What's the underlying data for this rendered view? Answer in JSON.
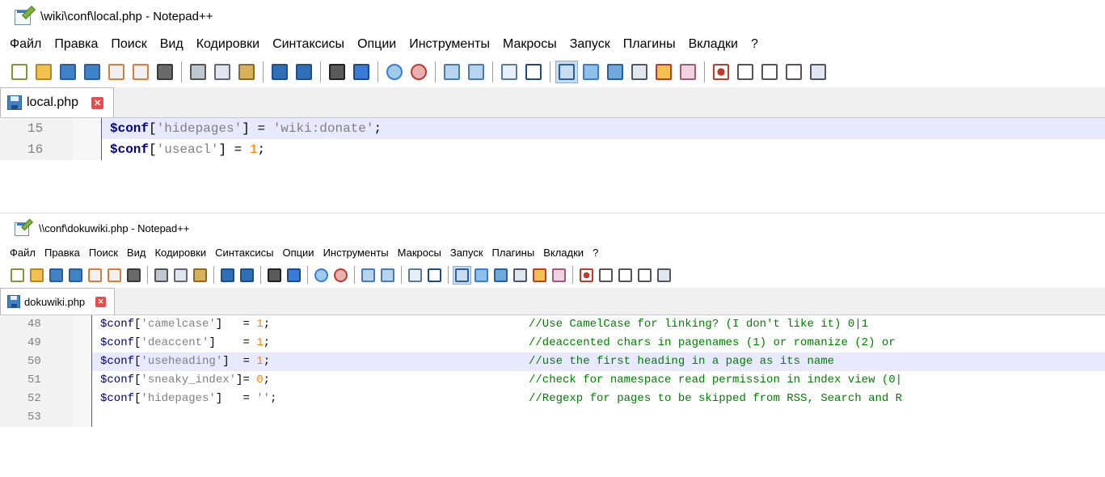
{
  "window1": {
    "title": "\\wiki\\conf\\local.php - Notepad++",
    "menu": [
      "Файл",
      "Правка",
      "Поиск",
      "Вид",
      "Кодировки",
      "Синтаксисы",
      "Опции",
      "Инструменты",
      "Макросы",
      "Запуск",
      "Плагины",
      "Вкладки",
      "?"
    ],
    "tab_label": "local.php",
    "lines": [
      {
        "num": "15",
        "code": "$conf['hidepages'] = 'wiki:donate';"
      },
      {
        "num": "16",
        "code": "$conf['useacl'] = 1;"
      }
    ]
  },
  "window2": {
    "title": "\\\\conf\\dokuwiki.php - Notepad++",
    "menu": [
      "Файл",
      "Правка",
      "Поиск",
      "Вид",
      "Кодировки",
      "Синтаксисы",
      "Опции",
      "Инструменты",
      "Макросы",
      "Запуск",
      "Плагины",
      "Вкладки",
      "?"
    ],
    "tab_label": "dokuwiki.php",
    "lines": [
      {
        "num": "48",
        "code": "$conf['camelcase']   = 1;",
        "comment": "//Use CamelCase for linking? (I don't like it) 0|1"
      },
      {
        "num": "49",
        "code": "$conf['deaccent']    = 1;",
        "comment": "//deaccented chars in pagenames (1) or romanize (2) or"
      },
      {
        "num": "50",
        "code": "$conf['useheading']  = 1;",
        "comment": "//use the first heading in a page as its name"
      },
      {
        "num": "51",
        "code": "$conf['sneaky_index']= 0;",
        "comment": "//check for namespace read permission in index view (0|"
      },
      {
        "num": "52",
        "code": "$conf['hidepages']   = '';",
        "comment": "//Regexp for pages to be skipped from RSS, Search and R"
      },
      {
        "num": "53",
        "code": "",
        "comment": ""
      }
    ]
  },
  "toolbar_icons": [
    "new-file-icon",
    "open-file-icon",
    "save-icon",
    "save-all-icon",
    "close-icon",
    "close-all-icon",
    "print-icon",
    "cut-icon",
    "copy-icon",
    "paste-icon",
    "undo-icon",
    "redo-icon",
    "find-icon",
    "replace-icon",
    "zoom-in-icon",
    "zoom-out-icon",
    "sync-vertical-icon",
    "sync-horizontal-icon",
    "word-wrap-icon",
    "show-all-chars-icon",
    "indent-guide-icon",
    "user-lang-icon",
    "doc-map-icon",
    "function-list-icon",
    "folder-as-workspace-icon",
    "monitoring-icon",
    "start-record-icon",
    "stop-record-icon",
    "playback-icon",
    "run-multiple-icon",
    "save-macro-icon"
  ],
  "colors": {
    "accent": "#3f82c8",
    "line_highlight": "#e8e8ff",
    "keyword": "#000080",
    "string": "#808080",
    "number": "#ff8000",
    "comment": "#008000",
    "gutter_border": "#c0392b"
  }
}
